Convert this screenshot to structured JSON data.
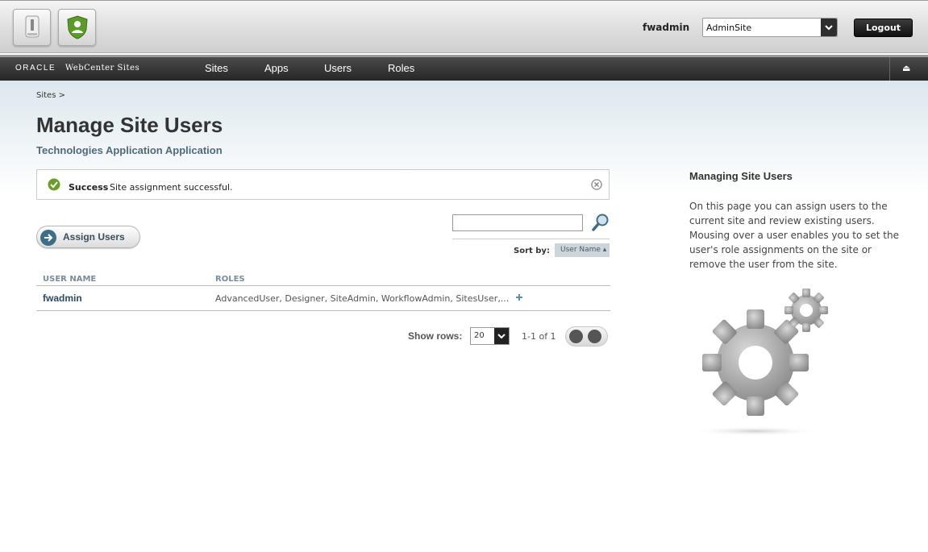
{
  "header": {
    "user_name": "fwadmin",
    "site_select": {
      "value": "AdminSite"
    },
    "logout_label": "Logout"
  },
  "navbar": {
    "brand_oracle": "ORACLE",
    "brand_product": "WebCenter Sites",
    "items": [
      "Sites",
      "Apps",
      "Users",
      "Roles"
    ]
  },
  "breadcrumb": "Sites >",
  "page": {
    "title": "Manage Site Users",
    "subtitle": "Technologies Application Application"
  },
  "success": {
    "label": "Success",
    "message": "Site assignment successful."
  },
  "assign_label": "Assign Users",
  "sort": {
    "label": "Sort by:",
    "value": "User Name ▴"
  },
  "table": {
    "headers": [
      "USER NAME",
      "ROLES"
    ],
    "rows": [
      {
        "user": "fwadmin",
        "roles": "AdvancedUser, Designer, SiteAdmin, WorkflowAdmin, SitesUser,..."
      }
    ]
  },
  "pagination": {
    "rows_label": "Show rows:",
    "rows_value": "20",
    "range": "1-1 of 1"
  },
  "help": {
    "title": "Managing Site Users",
    "body": "On this page you can assign users to the current site and review existing users. Mousing over a user enables you to set the user's role assignments on the site or remove the user from the site."
  },
  "colors": {
    "navbar": "#2e2e2e",
    "subtitle": "#4f6a7b",
    "success_icon": "#6a9e2a",
    "assign_icon": "#3e6d85"
  }
}
